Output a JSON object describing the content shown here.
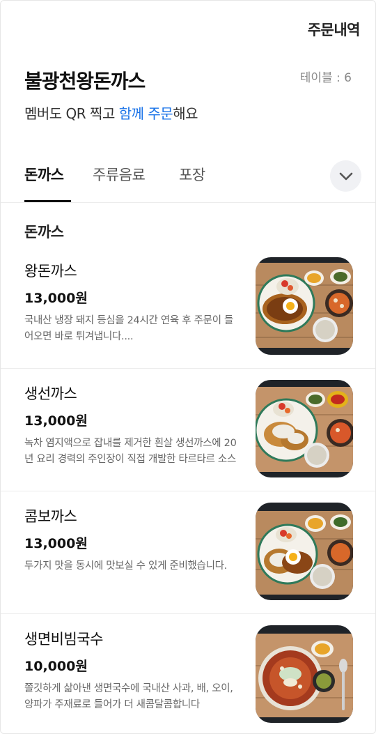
{
  "header": {
    "order_history": "주문내역",
    "store_name": "불광천왕돈까스",
    "table": "테이블 : 6",
    "subtitle_prefix": "멤버도 QR 찍고 ",
    "subtitle_accent": "함께 주문",
    "subtitle_suffix": "해요"
  },
  "tabs": [
    {
      "label": "돈까스",
      "active": true
    },
    {
      "label": "주류음료",
      "active": false
    },
    {
      "label": "포장",
      "active": false
    }
  ],
  "tabs_toggle_icon": "chevron-down-icon",
  "section": {
    "title": "돈까스"
  },
  "menu": [
    {
      "name": "왕돈까스",
      "price": "13,000원",
      "desc": "국내산 냉장 돼지 등심을 24시간 연육 후 주문이 들어오면 바로 튀겨냅니다...."
    },
    {
      "name": "생선까스",
      "price": "13,000원",
      "desc": "녹차 염지액으로 잡내를 제거한 흰살 생선까스에 20년 요리 경력의 주인장이 직접 개발한 타르타르 소스"
    },
    {
      "name": "콤보까스",
      "price": "13,000원",
      "desc": "두가지 맛을 동시에 맛보실 수 있게 준비했습니다."
    },
    {
      "name": "생면비빔국수",
      "price": "10,000원",
      "desc": "쫄깃하게 삶아낸 생면국수에 국내산 사과, 배, 오이, 양파가 주재료로 들어가 더 새콤달콤합니다"
    }
  ],
  "colors": {
    "accent": "#1a73e8",
    "text": "#111111",
    "muted": "#666666"
  }
}
